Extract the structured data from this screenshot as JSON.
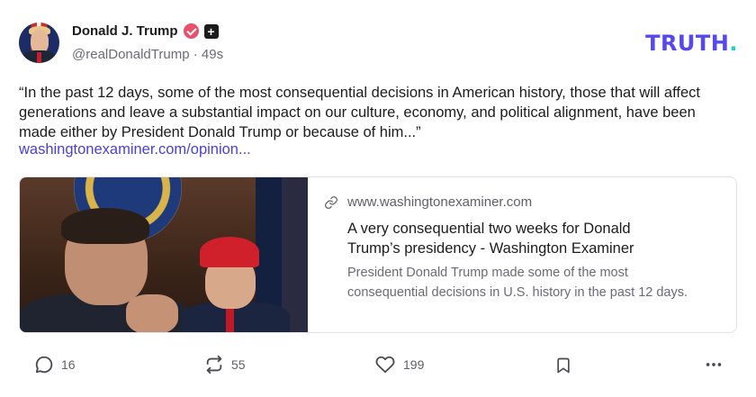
{
  "author": {
    "display_name": "Donald J. Trump",
    "handle": "@realDonaldTrump",
    "separator": "·",
    "time_ago": "49s",
    "plus_symbol": "+"
  },
  "brand": {
    "logo_text": "TRUTH",
    "logo_dot": ".",
    "logo_color": "#5448ee",
    "dot_color": "#18d7c4"
  },
  "post": {
    "text": "“In the past 12 days, some of the most consequential decisions in American history, those that will affect generations and leave a substantial impact on our culture, economy, and political alignment, have been made either by President Donald Trump or because of him...”",
    "link_text": "washingtonexaminer.com/opinion..."
  },
  "card": {
    "domain": "www.washingtonexaminer.com",
    "title": "A very consequential two weeks for Donald Trump’s presidency - Washington Examiner",
    "description": "President Donald Trump made some of the most consequential decisions in U.S. history in the past 12 days."
  },
  "actions": {
    "replies": "16",
    "retruths": "55",
    "likes": "199"
  },
  "icons": {
    "verified": "verified-badge-icon",
    "plus": "plus-badge-icon",
    "link": "link-icon",
    "reply": "comment-icon",
    "retruth": "repost-icon",
    "like": "heart-icon",
    "bookmark": "bookmark-icon",
    "more": "more-icon"
  }
}
